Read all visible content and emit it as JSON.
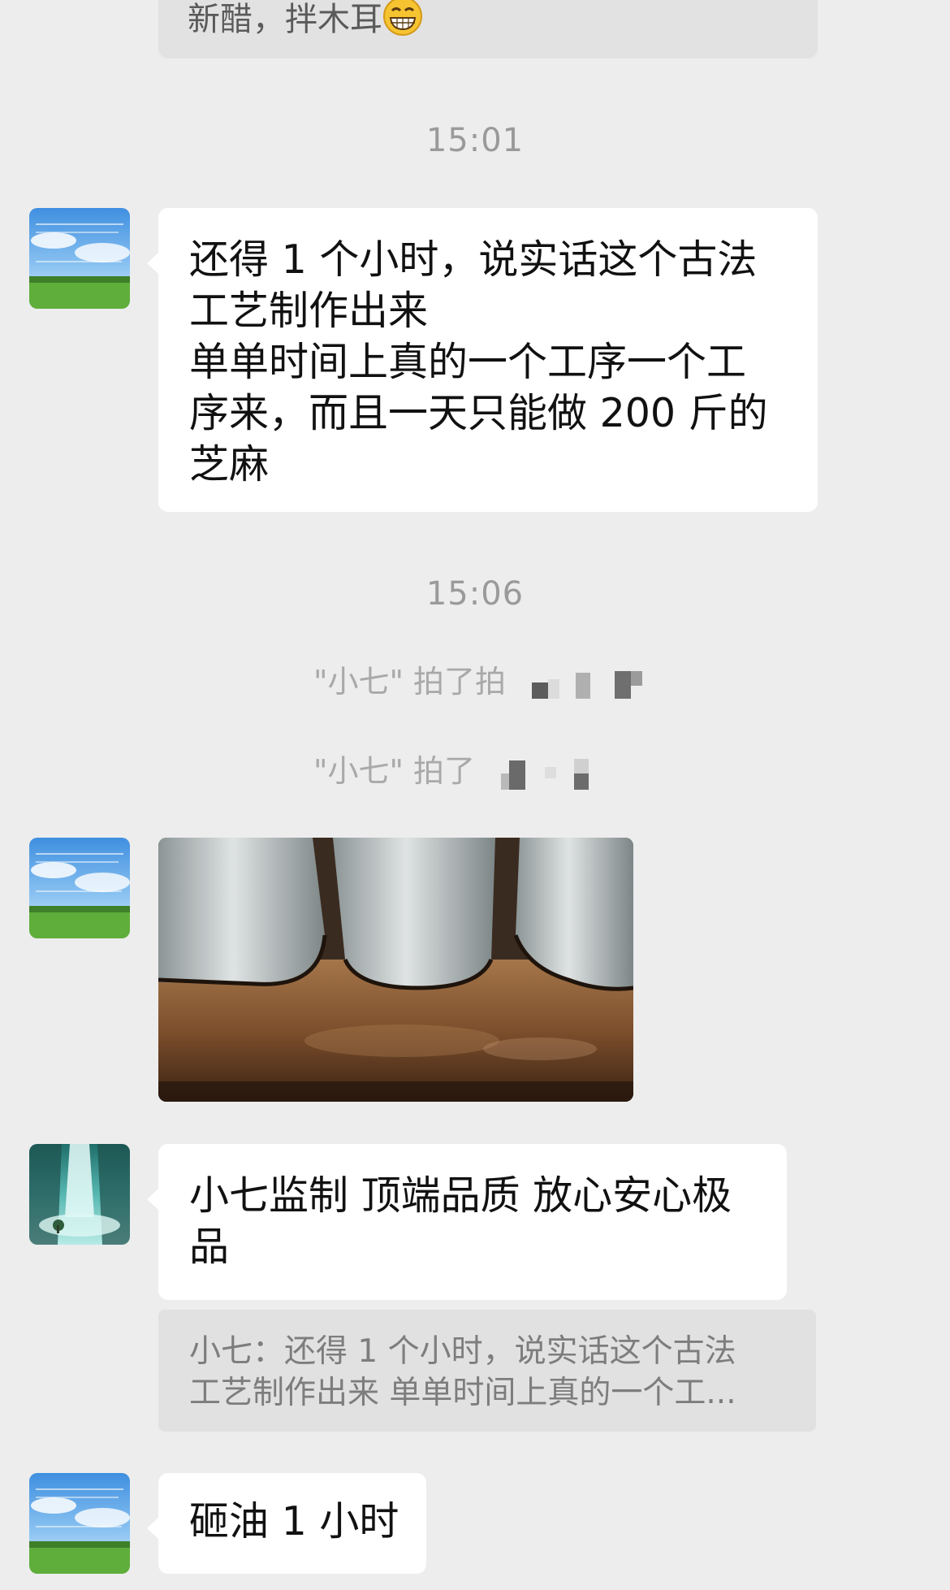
{
  "messages": {
    "top_partial": {
      "text": "新醋，拌木耳",
      "emoji": "grin-emoji"
    },
    "time1": "15:01",
    "msg1_lines": [
      "还得 1 个小时，说实话这个古法",
      "工艺制作出来",
      "单单时间上真的一个工序一个工",
      "序来，而且一天只能做 200 斤的",
      "芝麻"
    ],
    "time2": "15:06",
    "system1": "\"小七\" 拍了拍",
    "system2": "\"小七\" 拍了",
    "msg3_lines": [
      "小七监制 顶端品质 放心安心极",
      "品"
    ],
    "quote_lines": [
      "小七：还得 1 个小时，说实话这个古法",
      "工艺制作出来 单单时间上真的一个工..."
    ],
    "msg4": "砸油 1 小时"
  },
  "colors": {
    "background": "#ededed",
    "bubble": "#ffffff",
    "quote_bg": "#e1e1e1",
    "time_text": "#9a9a9a"
  },
  "icons": {
    "avatar_a": "sky-field-avatar",
    "avatar_b": "waterfall-avatar",
    "photo": "sesame-oil-pots-photo"
  }
}
